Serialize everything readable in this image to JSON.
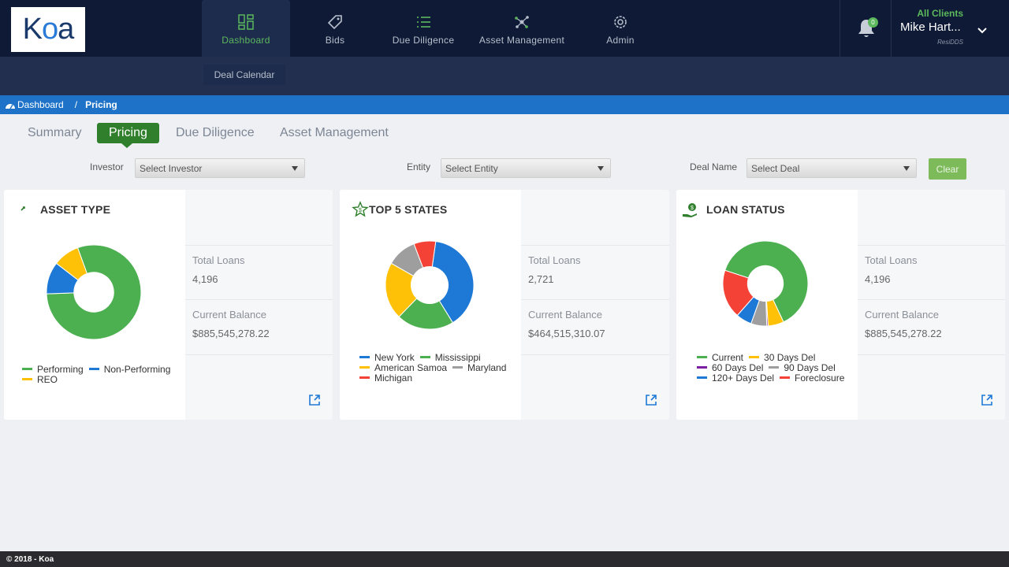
{
  "header": {
    "logo": "Koa",
    "nav": [
      {
        "label": "Dashboard",
        "icon": "dashboard-grid-icon",
        "active": true
      },
      {
        "label": "Bids",
        "icon": "tag-icon"
      },
      {
        "label": "Due Diligence",
        "icon": "list-icon"
      },
      {
        "label": "Asset Management",
        "icon": "network-icon"
      },
      {
        "label": "Admin",
        "icon": "gear-icon"
      }
    ],
    "subnav": "Deal Calendar",
    "notifications": "0",
    "client_label": "All Clients",
    "user_name": "Mike Hart...",
    "user_org": "ResiDDS"
  },
  "breadcrumb": {
    "home": "Dashboard",
    "current": "Pricing"
  },
  "tabs": [
    {
      "label": "Summary"
    },
    {
      "label": "Pricing",
      "active": true
    },
    {
      "label": "Due Diligence"
    },
    {
      "label": "Asset Management"
    }
  ],
  "filters": {
    "investor": {
      "label": "Investor",
      "value": "Select Investor"
    },
    "entity": {
      "label": "Entity",
      "value": "Select Entity"
    },
    "deal": {
      "label": "Deal Name",
      "value": "Select Deal"
    },
    "clear": "Clear"
  },
  "colors": {
    "green": "#4caf50",
    "blue": "#1e78d6",
    "yellow": "#ffc107",
    "gray": "#9e9e9e",
    "red": "#f44336",
    "purple": "#7b1fa2"
  },
  "cards": [
    {
      "title": "ASSET TYPE",
      "total_loans_label": "Total Loans",
      "total_loans": "4,196",
      "balance_label": "Current Balance",
      "balance": "$885,545,278.22",
      "legend": [
        [
          "Performing",
          "Non-Performing"
        ],
        [
          "REO"
        ]
      ]
    },
    {
      "title": "TOP 5 STATES",
      "total_loans_label": "Total Loans",
      "total_loans": "2,721",
      "balance_label": "Current Balance",
      "balance": "$464,515,310.07",
      "legend": [
        [
          "New York",
          "Mississippi"
        ],
        [
          "American Samoa",
          "Maryland"
        ],
        [
          "Michigan"
        ]
      ]
    },
    {
      "title": "LOAN STATUS",
      "total_loans_label": "Total Loans",
      "total_loans": "4,196",
      "balance_label": "Current Balance",
      "balance": "$885,545,278.22",
      "legend": [
        [
          "Current",
          "30 Days Del"
        ],
        [
          "60 Days Del",
          "90 Days Del"
        ],
        [
          "120+ Days Del",
          "Foreclosure"
        ]
      ]
    }
  ],
  "chart_data": [
    {
      "type": "pie",
      "title": "ASSET TYPE",
      "labels": [
        "Performing",
        "Non-Performing",
        "REO"
      ],
      "values": [
        80,
        11,
        9
      ],
      "colors": [
        "#4caf50",
        "#1e78d6",
        "#ffc107"
      ]
    },
    {
      "type": "pie",
      "title": "TOP 5 STATES",
      "labels": [
        "New York",
        "Mississippi",
        "American Samoa",
        "Maryland",
        "Michigan"
      ],
      "values": [
        39,
        21,
        21,
        11,
        8
      ],
      "colors": [
        "#1e78d6",
        "#4caf50",
        "#ffc107",
        "#9e9e9e",
        "#f44336"
      ]
    },
    {
      "type": "pie",
      "title": "LOAN STATUS",
      "labels": [
        "Current",
        "30 Days Del",
        "60 Days Del",
        "90 Days Del",
        "120+ Days Del",
        "Foreclosure"
      ],
      "values": [
        63,
        6,
        0.5,
        6,
        6,
        18.5
      ],
      "colors": [
        "#4caf50",
        "#ffc107",
        "#7b1fa2",
        "#9e9e9e",
        "#1e78d6",
        "#f44336"
      ]
    }
  ],
  "footer": "© 2018 - Koa"
}
